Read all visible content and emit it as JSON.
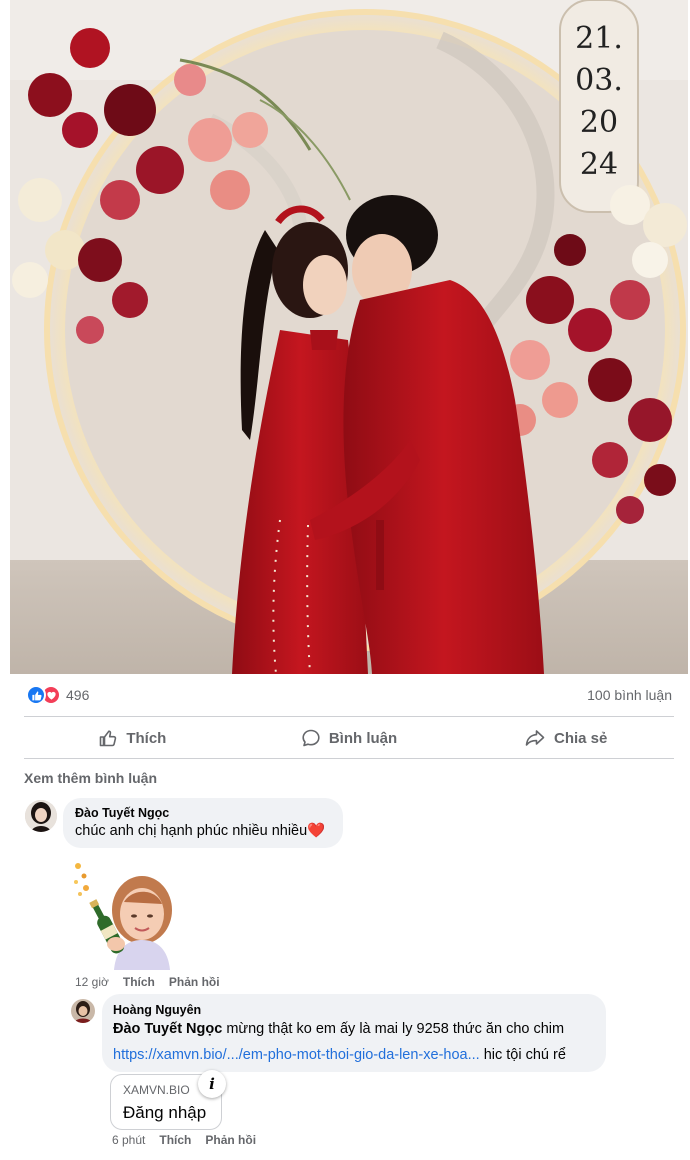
{
  "photo": {
    "date_lines": [
      "21.",
      "03.",
      "20",
      "24"
    ],
    "colors": {
      "dress": "#b3121c",
      "accent_light": "#f3d9a8"
    }
  },
  "reactions": {
    "icons": [
      "like-icon",
      "love-icon"
    ],
    "count": "496",
    "comments_label": "100 bình luận"
  },
  "actions": {
    "like": "Thích",
    "comment": "Bình luận",
    "share": "Chia sẻ"
  },
  "see_more": "Xem thêm bình luận",
  "comments": [
    {
      "author": "Đào Tuyết Ngọc",
      "text": "chúc anh chị hạnh phúc nhiều nhiều",
      "emoji": "❤️",
      "time": "12 giờ",
      "like": "Thích",
      "reply": "Phản hồi"
    },
    {
      "author": "Hoàng Nguyên",
      "mention": "Đào Tuyết Ngọc",
      "text": " mừng thật ko em ấy là mai ly 9258 thức ăn cho chim",
      "link": "https://xamvn.bio/.../em-pho-mot-thoi-gio-da-len-xe-hoa...",
      "text_after_link": " hic tội chú rể",
      "preview_domain": "XAMVN.BIO",
      "preview_title": "Đăng nhập",
      "time": "6 phút",
      "like": "Thích",
      "reply": "Phản hồi"
    }
  ]
}
